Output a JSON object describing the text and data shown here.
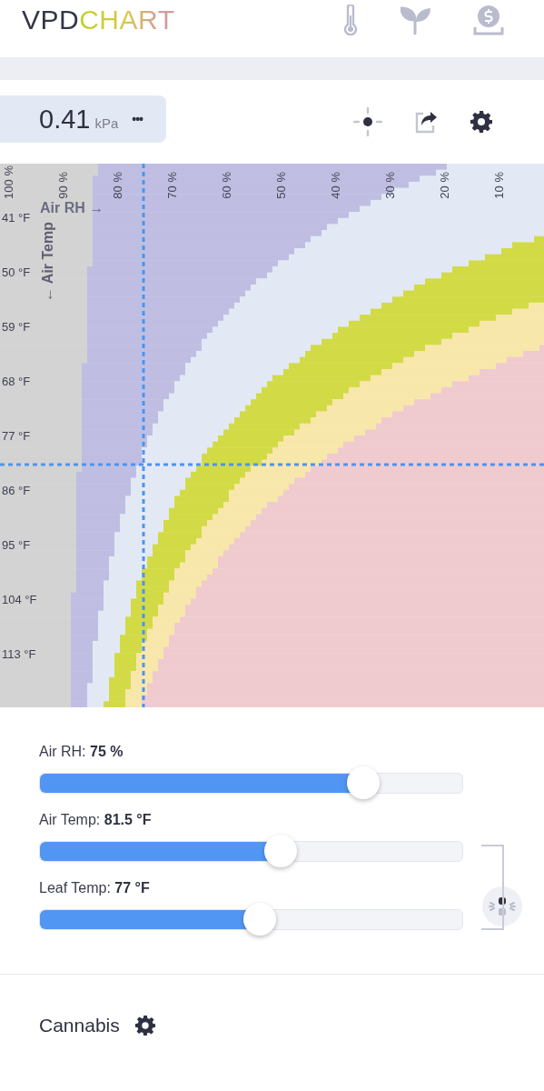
{
  "header": {
    "logo": {
      "part_1": "VPD",
      "part_2": "CHART"
    }
  },
  "reading": {
    "value": "0.41",
    "unit": "kPa",
    "more": "•••"
  },
  "chart": {
    "rh_axis_title": "Air RH →",
    "temp_axis_title": "← Air Temp",
    "rh_labels": [
      "100 %",
      "90 %",
      "80 %",
      "70 %",
      "60 %",
      "50 %",
      "40 %",
      "30 %",
      "20 %",
      "10 %"
    ],
    "temp_labels": [
      "41 °F",
      "50 °F",
      "59 °F",
      "68 °F",
      "77 °F",
      "86 °F",
      "95 °F",
      "104 °F",
      "113 °F"
    ]
  },
  "sliders": [
    {
      "label": "Air RH: ",
      "value": "75 %",
      "level": 0.765
    },
    {
      "label": "Air Temp: ",
      "value": "81.5 °F",
      "level": 0.57
    },
    {
      "label": "Leaf Temp: ",
      "value": "77 °F",
      "level": 0.52
    }
  ],
  "crop": {
    "name": "Cannabis"
  }
}
